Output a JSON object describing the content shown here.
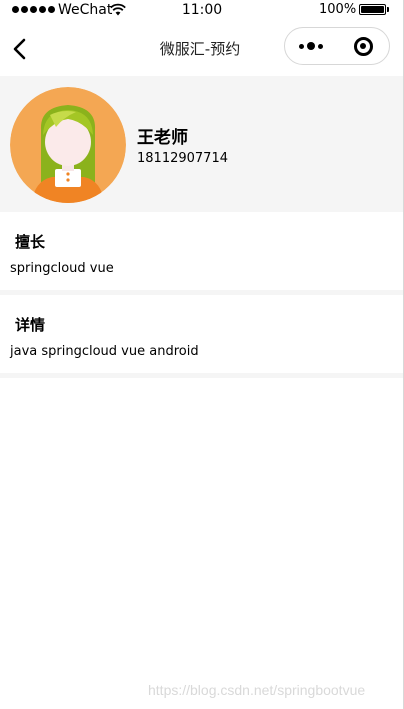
{
  "status_bar": {
    "carrier": "WeChat",
    "time": "11:00",
    "battery": "100%"
  },
  "nav": {
    "title": "微服汇-预约"
  },
  "teacher": {
    "name": "王老师",
    "phone": "18112907714"
  },
  "sections": {
    "specialty": {
      "title": "擅长",
      "content": "springcloud vue"
    },
    "details": {
      "title": "详情",
      "content": "java springcloud vue android"
    }
  },
  "watermark": "https://blog.csdn.net/springbootvue",
  "icons": {
    "back": "chevron-left-icon",
    "more": "more-dots-icon",
    "close": "capsule-close-icon",
    "avatar": "avatar-girl-illustration"
  },
  "colors": {
    "avatar_bg": "#f4a753",
    "hair": "#8bb21c",
    "dress": "#f08424",
    "header_bg": "#f5f5f5"
  }
}
